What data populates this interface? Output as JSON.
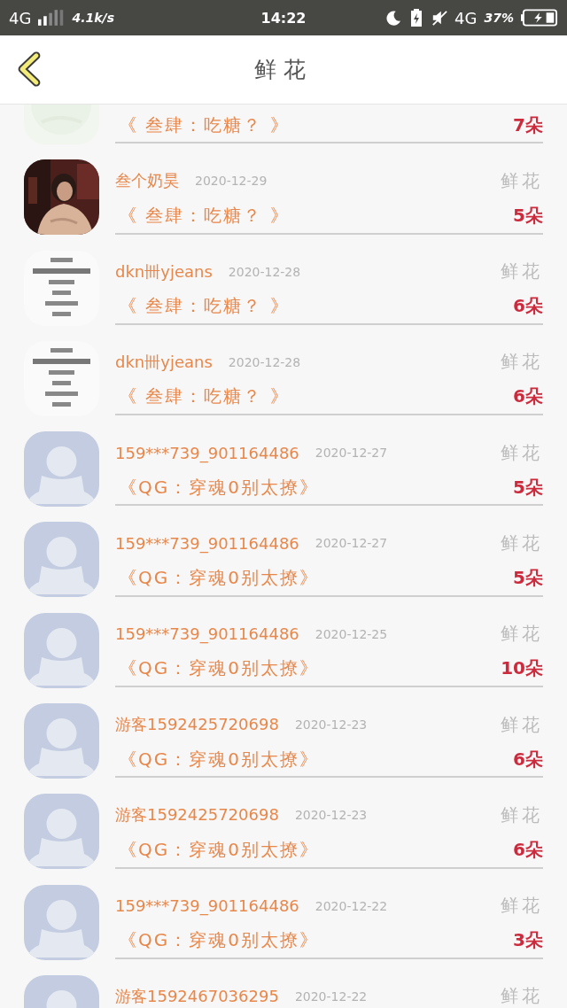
{
  "status_bar": {
    "network": "4G",
    "speed": "4.1k/s",
    "time": "14:22",
    "network_2": "4G",
    "battery": "37%"
  },
  "header": {
    "title": "鲜花"
  },
  "records": [
    {
      "avatar": {
        "kind": "pale"
      },
      "book": "《 叁肆：吃糖？ 》",
      "count": "7朵"
    },
    {
      "name": "叁个奶昊",
      "date": "2020-12-29",
      "label": "鲜花",
      "book": "《 叁肆：吃糖？ 》",
      "count": "5朵"
    },
    {
      "avatar": {
        "kind": "poster"
      },
      "name": "dkn卌yjeans",
      "date": "2020-12-28",
      "label": "鲜花",
      "book": "《 叁肆：吃糖？ 》",
      "count": "6朵"
    },
    {
      "avatar": {
        "kind": "poster"
      },
      "name": "dkn卌yjeans",
      "date": "2020-12-28",
      "label": "鲜花",
      "book": "《 叁肆：吃糖？ 》",
      "count": "6朵"
    },
    {
      "avatar": {
        "kind": "default"
      },
      "name": "159***739_901164486",
      "date": "2020-12-27",
      "label": "鲜花",
      "book": "《QG：穿魂0别太撩》",
      "count": "5朵"
    },
    {
      "avatar": {
        "kind": "default"
      },
      "name": "159***739_901164486",
      "date": "2020-12-27",
      "label": "鲜花",
      "book": "《QG：穿魂0别太撩》",
      "count": "5朵"
    },
    {
      "avatar": {
        "kind": "default"
      },
      "name": "159***739_901164486",
      "date": "2020-12-25",
      "label": "鲜花",
      "book": "《QG：穿魂0别太撩》",
      "count": "10朵"
    },
    {
      "avatar": {
        "kind": "default"
      },
      "name": "游客1592425720698",
      "date": "2020-12-23",
      "label": "鲜花",
      "book": "《QG：穿魂0别太撩》",
      "count": "6朵"
    },
    {
      "avatar": {
        "kind": "default"
      },
      "name": "游客1592425720698",
      "date": "2020-12-23",
      "label": "鲜花",
      "book": "《QG：穿魂0别太撩》",
      "count": "6朵"
    },
    {
      "avatar": {
        "kind": "default"
      },
      "name": "159***739_901164486",
      "date": "2020-12-22",
      "label": "鲜花",
      "book": "《QG：穿魂0别太撩》",
      "count": "3朵"
    },
    {
      "avatar": {
        "kind": "default"
      },
      "name": "游客1592467036295",
      "date": "2020-12-22",
      "label": "鲜花"
    }
  ]
}
